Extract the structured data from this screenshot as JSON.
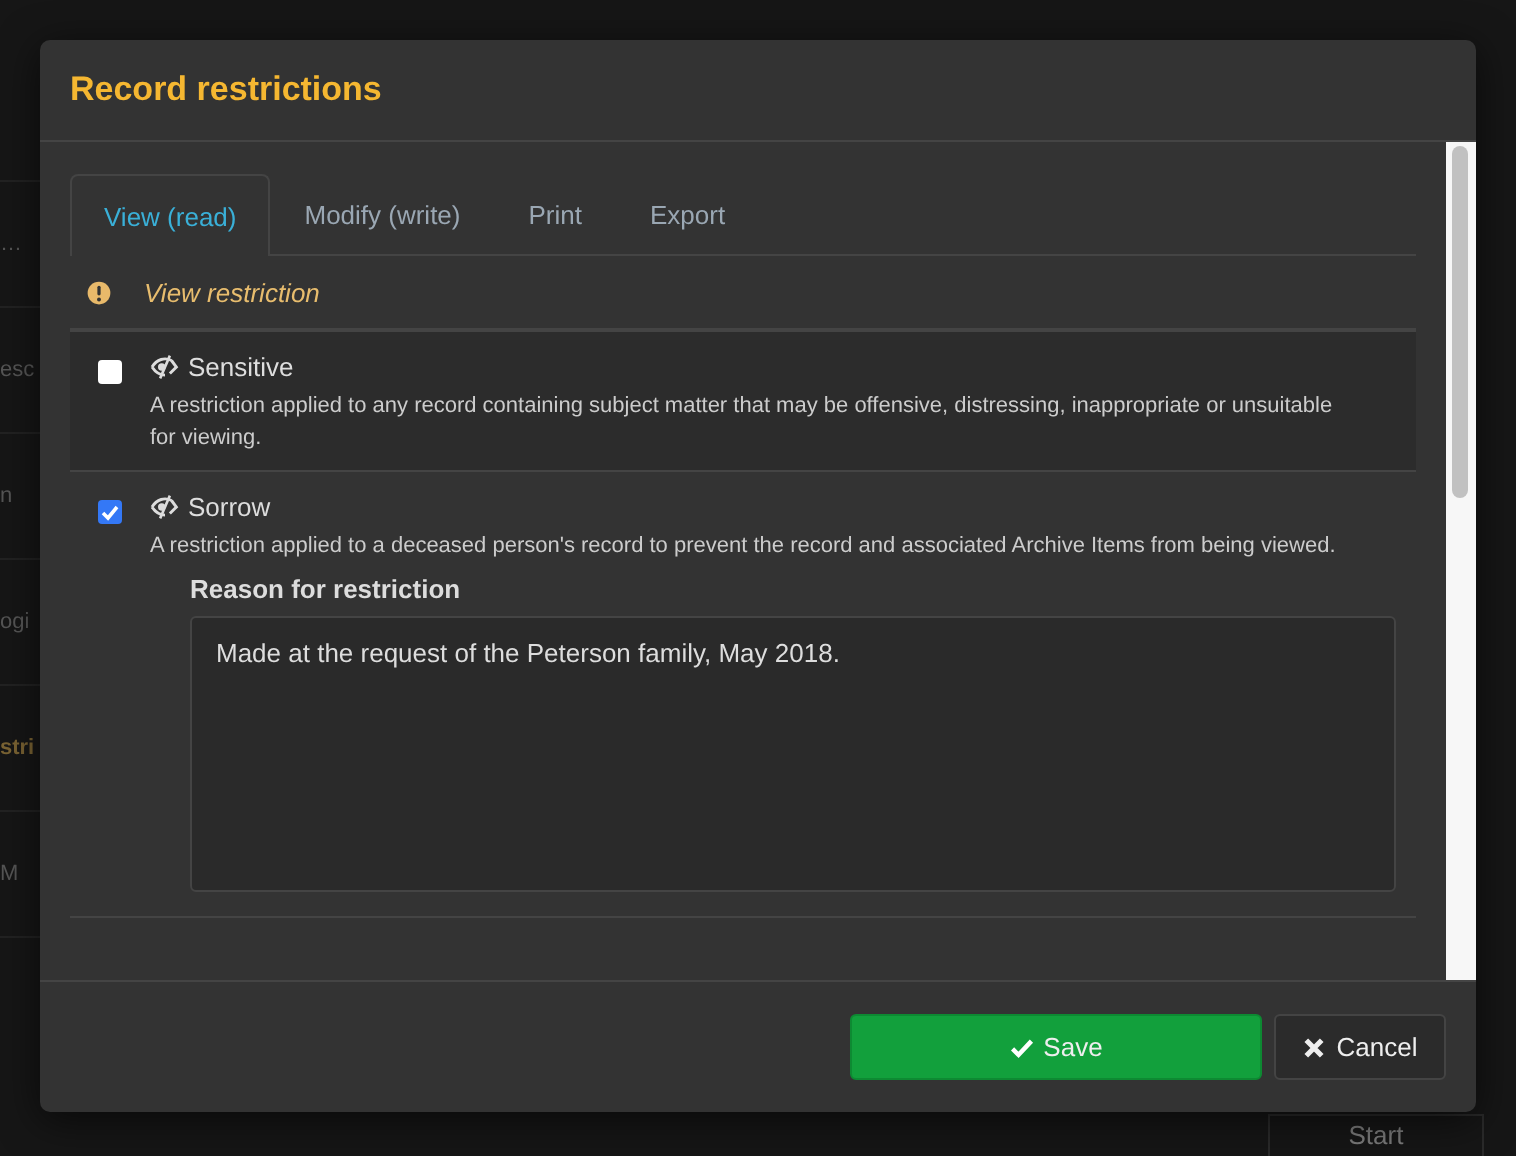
{
  "background": {
    "rows": [
      {
        "text": "…",
        "kind": "plain"
      },
      {
        "text": "esc",
        "kind": "plain"
      },
      {
        "text": "n",
        "kind": "plain"
      },
      {
        "text": "ogi",
        "kind": "plain"
      },
      {
        "text": "stri",
        "kind": "heading"
      },
      {
        "text": "M",
        "kind": "plain"
      }
    ],
    "start_button": "Start"
  },
  "dialog": {
    "title": "Record restrictions",
    "tabs": [
      {
        "label": "View (read)",
        "selected": true
      },
      {
        "label": "Modify (write)",
        "selected": false
      },
      {
        "label": "Print",
        "selected": false
      },
      {
        "label": "Export",
        "selected": false
      }
    ],
    "section": {
      "title": "View restriction"
    },
    "restrictions": [
      {
        "name": "Sensitive",
        "checked": false,
        "description": "A restriction applied to any record containing subject matter that may be offensive, distressing, inappropriate or unsuitable for viewing."
      },
      {
        "name": "Sorrow",
        "checked": true,
        "description": "A restriction applied to a deceased person's record to prevent the record and associated Archive Items from being viewed.",
        "reason": {
          "label": "Reason for restriction",
          "value": "Made at the request of the Peterson family, May 2018."
        }
      }
    ],
    "buttons": [
      {
        "label": "Save",
        "kind": "primary"
      },
      {
        "label": "Cancel",
        "kind": "secondary"
      }
    ]
  }
}
